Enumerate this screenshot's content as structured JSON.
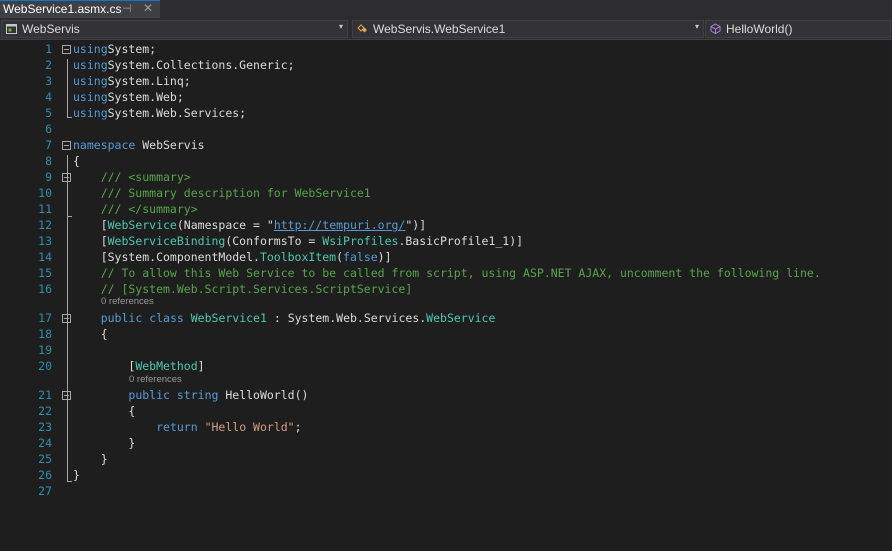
{
  "tab": {
    "title": "WebService1.asmx.cs",
    "pin": "⊣",
    "close": "✕"
  },
  "nav": {
    "project": "WebServis",
    "class_member": "WebServis.WebService1",
    "method": "HelloWorld()",
    "arrow": "▾"
  },
  "colors": {
    "keyword": "#569cd6",
    "comment": "#57a64a",
    "type": "#4ec9b0",
    "string": "#d69d85",
    "line_number": "#2b91af"
  },
  "editor": {
    "codelens_1": "0 references",
    "codelens_2": "0 references",
    "lines": [
      {
        "n": "1",
        "t": [
          [
            "kw",
            "using"
          ],
          [
            "",
            "System;"
          ]
        ]
      },
      {
        "n": "2",
        "t": [
          [
            "kw",
            "using"
          ],
          [
            "",
            "System.Collections.Generic;"
          ]
        ]
      },
      {
        "n": "3",
        "t": [
          [
            "kw",
            "using"
          ],
          [
            "",
            "System.Linq;"
          ]
        ]
      },
      {
        "n": "4",
        "t": [
          [
            "kw",
            "using"
          ],
          [
            "",
            "System.Web;"
          ]
        ]
      },
      {
        "n": "5",
        "t": [
          [
            "kw",
            "using"
          ],
          [
            "",
            "System.Web.Services;"
          ]
        ]
      },
      {
        "n": "6",
        "t": []
      },
      {
        "n": "7",
        "t": [
          [
            "kw",
            "namespace"
          ],
          [
            "",
            " WebServis"
          ]
        ]
      },
      {
        "n": "8",
        "t": [
          [
            "",
            "{"
          ]
        ]
      },
      {
        "n": "9",
        "t": [
          [
            "cm",
            "    /// <summary>"
          ]
        ]
      },
      {
        "n": "10",
        "t": [
          [
            "cm",
            "    /// Summary description for WebService1"
          ]
        ]
      },
      {
        "n": "11",
        "t": [
          [
            "cm",
            "    /// </summary>"
          ]
        ]
      },
      {
        "n": "12",
        "t": [
          [
            "",
            "    ["
          ],
          [
            "ty",
            "WebService"
          ],
          [
            "",
            "(Namespace = \""
          ],
          [
            "lk",
            "http://tempuri.org/"
          ],
          [
            "",
            "\")]"
          ]
        ]
      },
      {
        "n": "13",
        "t": [
          [
            "",
            "    ["
          ],
          [
            "ty",
            "WebServiceBinding"
          ],
          [
            "",
            "(ConformsTo = "
          ],
          [
            "ty",
            "WsiProfiles"
          ],
          [
            "",
            ".BasicProfile1_1)]"
          ]
        ]
      },
      {
        "n": "14",
        "t": [
          [
            "",
            "    [System.ComponentModel."
          ],
          [
            "ty",
            "ToolboxItem"
          ],
          [
            "",
            "("
          ],
          [
            "kw",
            "false"
          ],
          [
            "",
            ")]"
          ]
        ]
      },
      {
        "n": "15",
        "t": [
          [
            "cm",
            "    // To allow this Web Service to be called from script, using ASP.NET AJAX, uncomment the following line."
          ]
        ]
      },
      {
        "n": "16",
        "t": [
          [
            "cm",
            "    // [System.Web.Script.Services.ScriptService]"
          ]
        ]
      },
      {
        "n": "17",
        "t": [
          [
            "",
            "    "
          ],
          [
            "kw",
            "public"
          ],
          [
            "",
            " "
          ],
          [
            "kw",
            "class"
          ],
          [
            "",
            " "
          ],
          [
            "ty",
            "WebService1"
          ],
          [
            "",
            " : System.Web.Services."
          ],
          [
            "ty",
            "WebService"
          ]
        ]
      },
      {
        "n": "18",
        "t": [
          [
            "",
            "    {"
          ]
        ]
      },
      {
        "n": "19",
        "t": []
      },
      {
        "n": "20",
        "t": [
          [
            "",
            "        ["
          ],
          [
            "ty",
            "WebMethod"
          ],
          [
            "",
            "]"
          ]
        ]
      },
      {
        "n": "21",
        "t": [
          [
            "",
            "        "
          ],
          [
            "kw",
            "public"
          ],
          [
            "",
            " "
          ],
          [
            "kw",
            "string"
          ],
          [
            "",
            " HelloWorld()"
          ]
        ]
      },
      {
        "n": "22",
        "t": [
          [
            "",
            "        {"
          ]
        ]
      },
      {
        "n": "23",
        "t": [
          [
            "",
            "            "
          ],
          [
            "kw",
            "return"
          ],
          [
            "",
            " "
          ],
          [
            "st",
            "\"Hello World\""
          ],
          [
            "",
            ";"
          ]
        ]
      },
      {
        "n": "24",
        "t": [
          [
            "",
            "        }"
          ]
        ]
      },
      {
        "n": "25",
        "t": [
          [
            "",
            "    }"
          ]
        ]
      },
      {
        "n": "26",
        "t": [
          [
            "",
            "}"
          ]
        ]
      },
      {
        "n": "27",
        "t": []
      }
    ]
  }
}
